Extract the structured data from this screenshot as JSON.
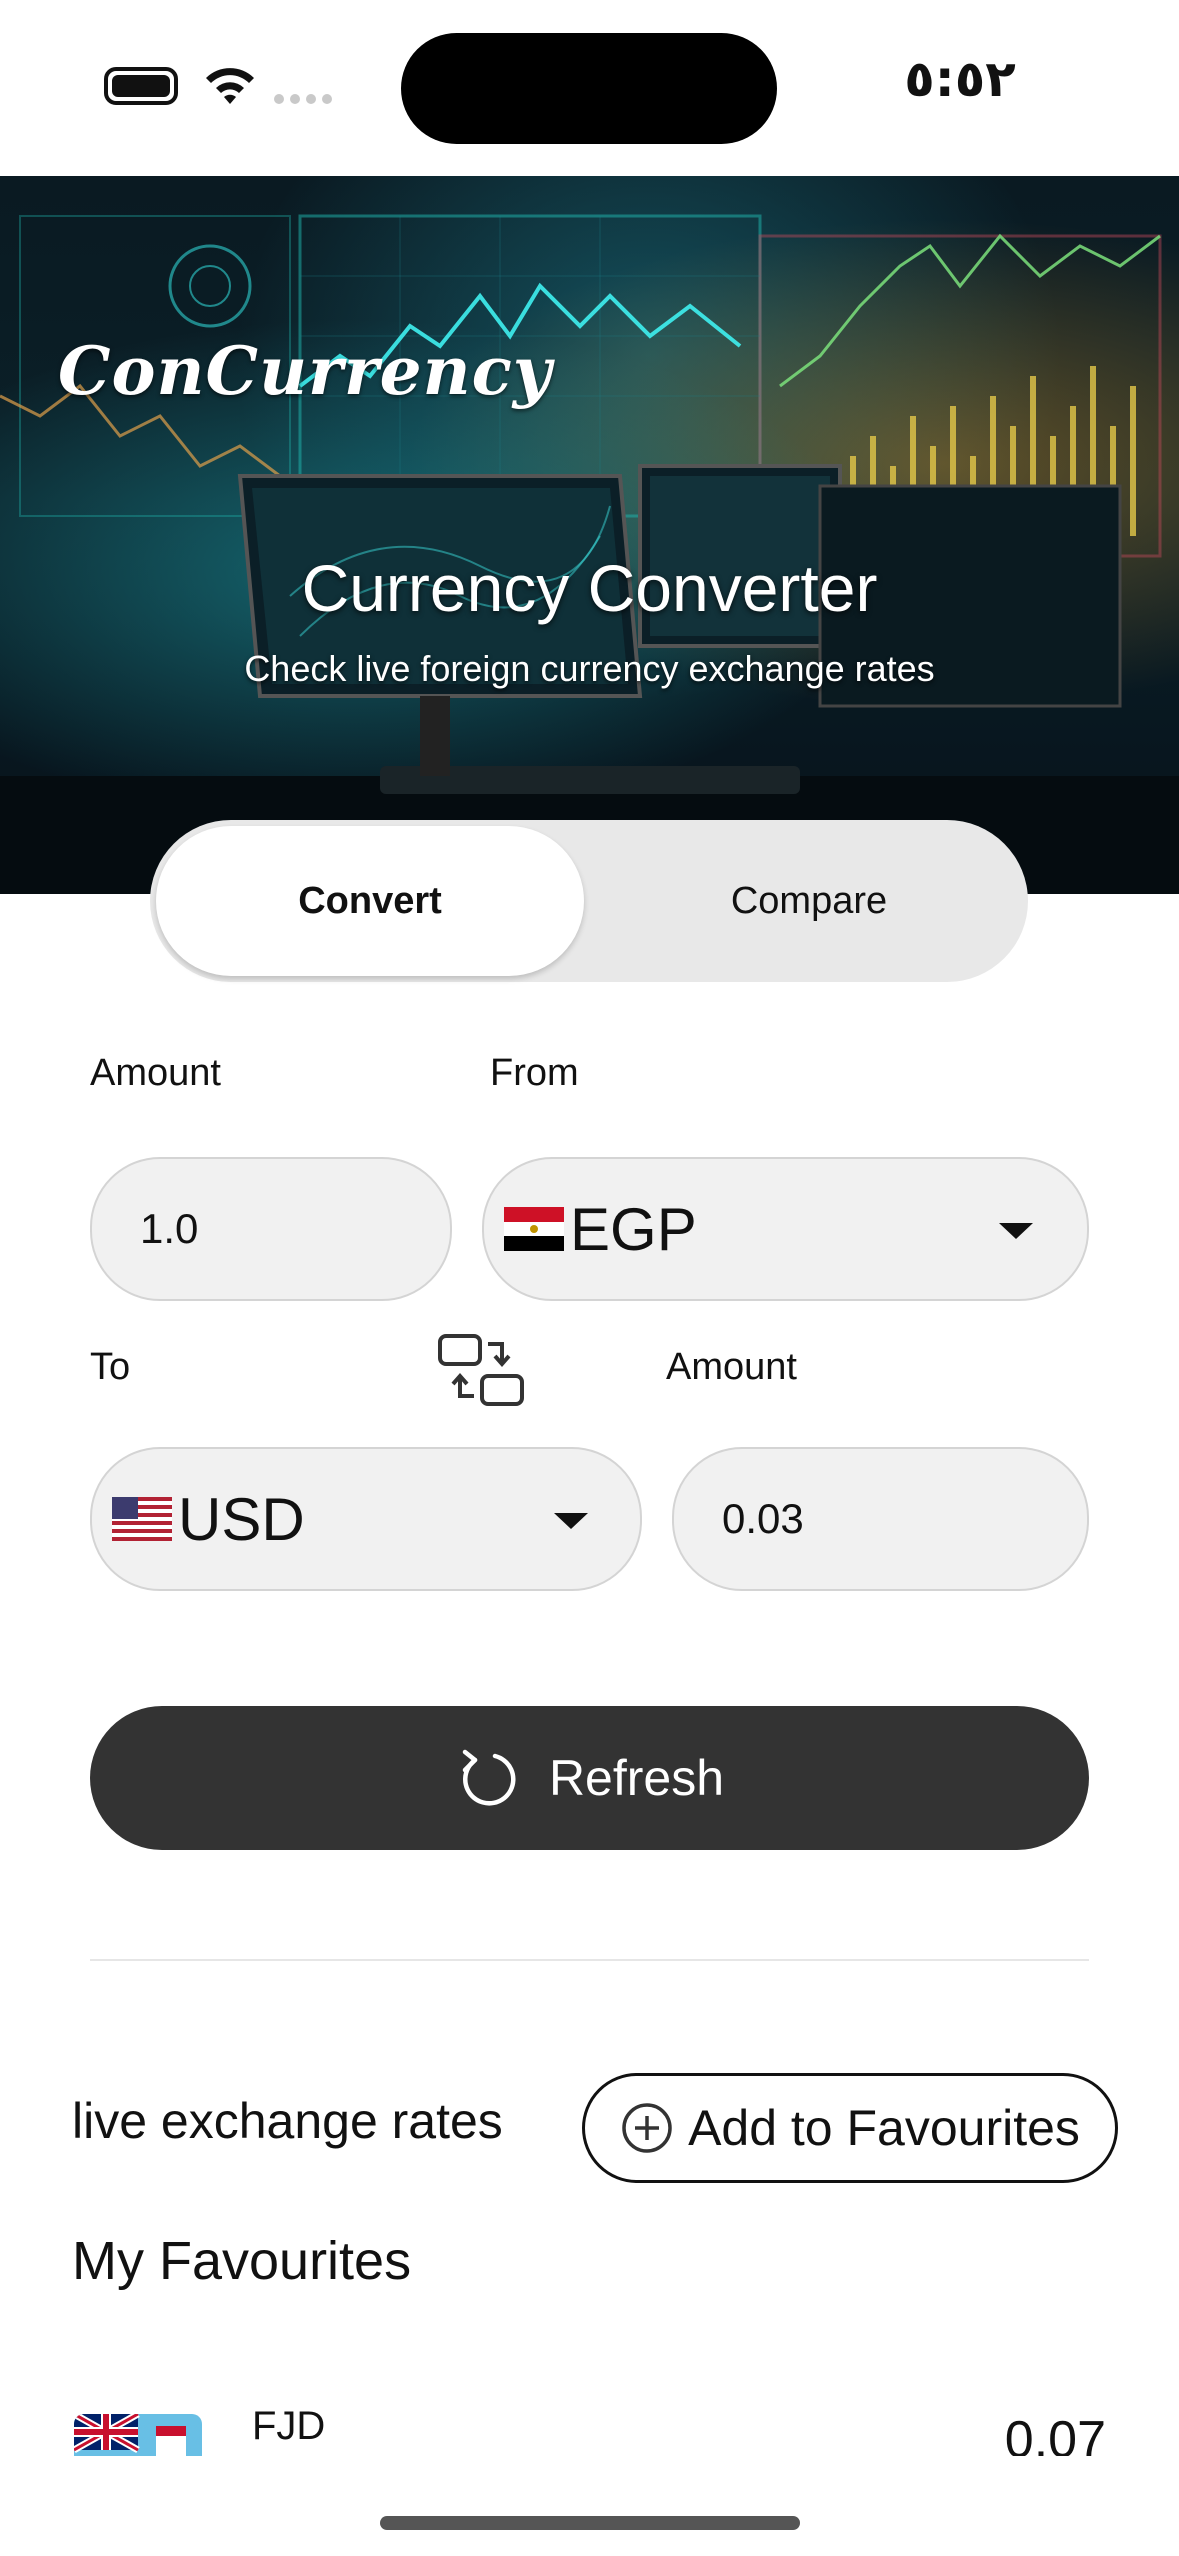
{
  "status_bar": {
    "time": "٥:٥٢"
  },
  "hero": {
    "brand": "ConCurrency",
    "title": "Currency Converter",
    "subtitle": "Check live foreign currency exchange rates"
  },
  "tabs": [
    {
      "label": "Convert",
      "active": true
    },
    {
      "label": "Compare",
      "active": false
    }
  ],
  "converter": {
    "amount_label": "Amount",
    "from_label": "From",
    "amount_value": "1.0",
    "from_currency": {
      "code": "EGP",
      "flag_emoji": "🇪🇬"
    },
    "to_label": "To",
    "result_label": "Amount",
    "to_currency": {
      "code": "USD",
      "flag_emoji": "🇺🇸"
    },
    "result_value": "0.03",
    "refresh_label": "Refresh"
  },
  "rates": {
    "live_label": "live exchange rates",
    "add_fav_label": "Add to Favourites",
    "favourites_title": "My Favourites",
    "favourites": [
      {
        "code": "FJD",
        "value": "0.07"
      }
    ]
  },
  "colors": {
    "primary_button": "#333333",
    "segment_bg": "#e8e8e8",
    "field_bg": "#f1f1f1"
  }
}
